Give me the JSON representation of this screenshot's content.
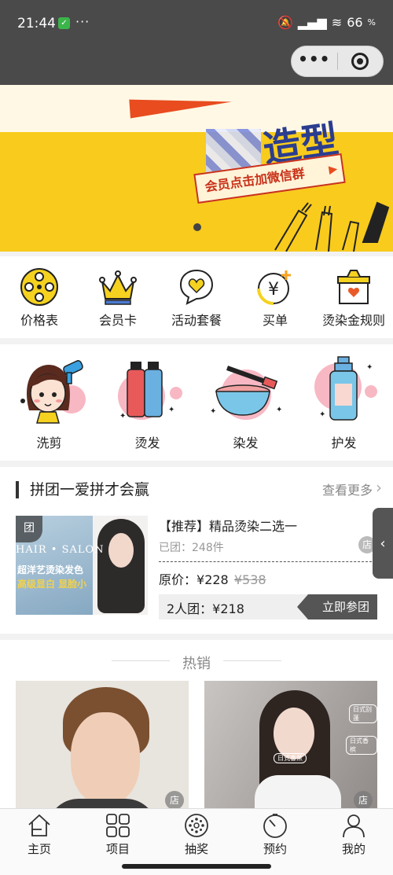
{
  "status_bar": {
    "time": "21:44",
    "dots": "···",
    "signal": "📶",
    "battery": "66"
  },
  "banner": {
    "title": "造型",
    "tag": "会员点击加微信群"
  },
  "menu": {
    "items": [
      {
        "label": "价格表",
        "icon": "film-reel-icon"
      },
      {
        "label": "会员卡",
        "icon": "crown-icon"
      },
      {
        "label": "活动套餐",
        "icon": "heart-chat-icon"
      },
      {
        "label": "买单",
        "icon": "yen-coin-icon"
      },
      {
        "label": "烫染金规则",
        "icon": "gift-box-icon"
      }
    ]
  },
  "categories": {
    "items": [
      {
        "label": "洗剪",
        "icon": "girl-dryer-icon"
      },
      {
        "label": "烫发",
        "icon": "hair-tubes-icon"
      },
      {
        "label": "染发",
        "icon": "dye-bowl-icon"
      },
      {
        "label": "护发",
        "icon": "spray-bottle-icon"
      }
    ]
  },
  "group_buy": {
    "title": "拼团一爱拼才会赢",
    "more": "查看更多",
    "product": {
      "badge": "团",
      "salon_text": "HAIR • SALON",
      "promo_line1": "超洋艺烫染发色",
      "promo_line2": "高级显白 显脸小",
      "name": "【推荐】精品烫染二选一",
      "sold": "已团：248件",
      "store": "店",
      "price_label": "原价：",
      "price": "¥228",
      "old_price": "¥538",
      "team_price": "2人团：¥218",
      "join": "立即参团"
    }
  },
  "side_tab": "‹",
  "hot": {
    "title": "热销",
    "store": "店",
    "labels": [
      "日式别蓬",
      "日式香槟",
      "日式香蕉"
    ]
  },
  "tabbar": {
    "items": [
      {
        "label": "主页",
        "icon": "home-icon"
      },
      {
        "label": "项目",
        "icon": "grid-icon"
      },
      {
        "label": "抽奖",
        "icon": "lottery-wheel-icon"
      },
      {
        "label": "预约",
        "icon": "clock-icon"
      },
      {
        "label": "我的",
        "icon": "user-icon"
      }
    ]
  }
}
